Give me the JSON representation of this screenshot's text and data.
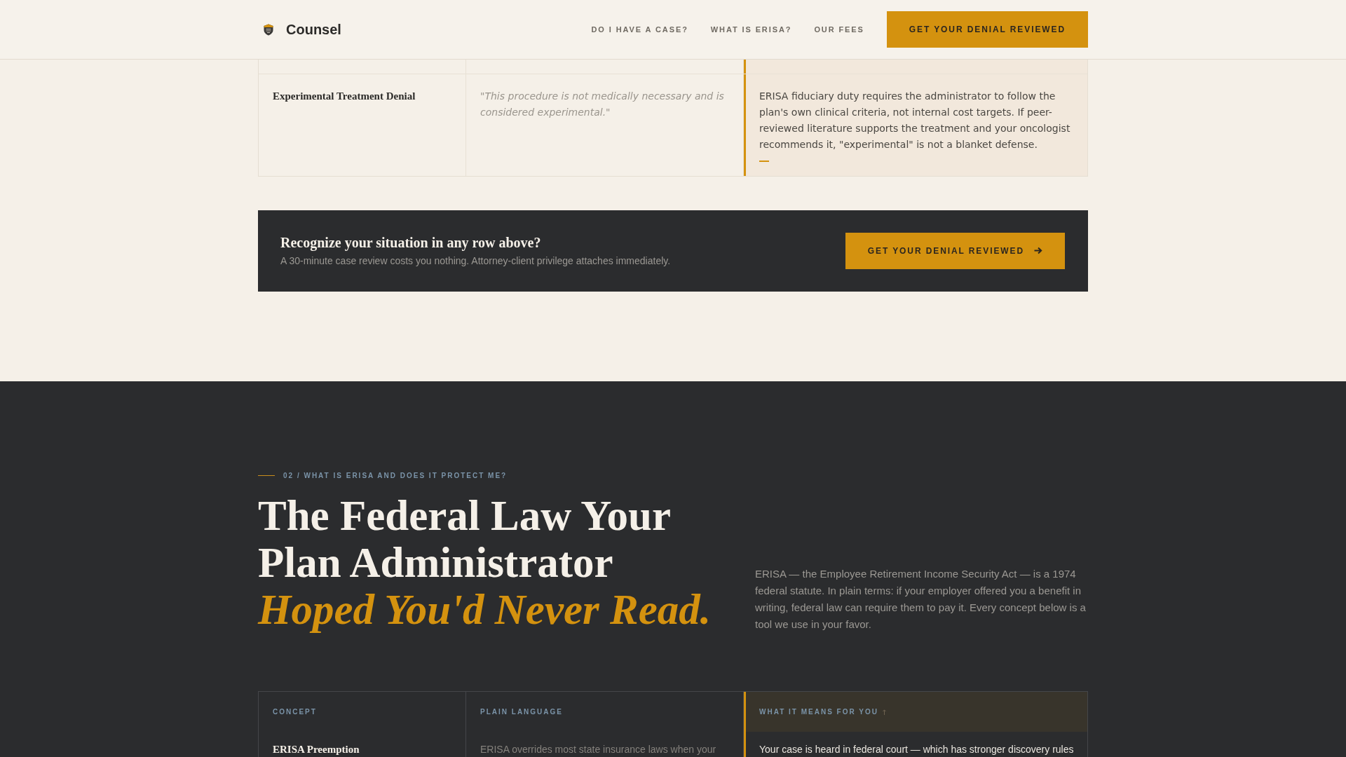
{
  "header": {
    "brand": "Counsel",
    "nav": [
      "DO I HAVE A CASE?",
      "WHAT IS ERISA?",
      "OUR FEES"
    ],
    "cta": "GET YOUR DENIAL REVIEWED"
  },
  "denial_table": {
    "rows": [
      {
        "column_1": "Experimental Treatment Denial",
        "column_2": "\"This procedure is not medically necessary and is considered experimental.\"",
        "column_3": "ERISA fiduciary duty requires the administrator to follow the plan's own clinical criteria, not internal cost targets. If peer-reviewed literature supports the treatment and your oncologist recommends it, \"experimental\" is not a blanket defense."
      }
    ]
  },
  "cta_band": {
    "title": "Recognize your situation in any row above?",
    "text": "A 30-minute case review costs you nothing. Attorney-client privilege attaches immediately.",
    "button": "GET YOUR DENIAL REVIEWED"
  },
  "erisa_section": {
    "eyebrow": "02 / WHAT IS ERISA AND DOES IT PROTECT ME?",
    "heading": "The Federal Law Your Plan Administrator *Hoped You'd Never Read.*",
    "intro": "ERISA — the Employee Retirement Income Security Act — is a 1974 federal statute. In plain terms: if your employer offered you a benefit in writing, federal law can require them to pay it. Every concept below is a tool we use in your favor.",
    "table": {
      "columns": [
        {
          "label": "CONCEPT",
          "arrow": false
        },
        {
          "label": "PLAIN LANGUAGE",
          "arrow": false
        },
        {
          "label": "WHAT IT MEANS FOR YOU",
          "arrow": true
        }
      ],
      "rows": [
        {
          "concept": "ERISA Preemption",
          "plain_language": "ERISA overrides most state insurance laws when your",
          "meaning": "Your case is heard in federal court — which has stronger discovery rules"
        }
      ]
    }
  }
}
